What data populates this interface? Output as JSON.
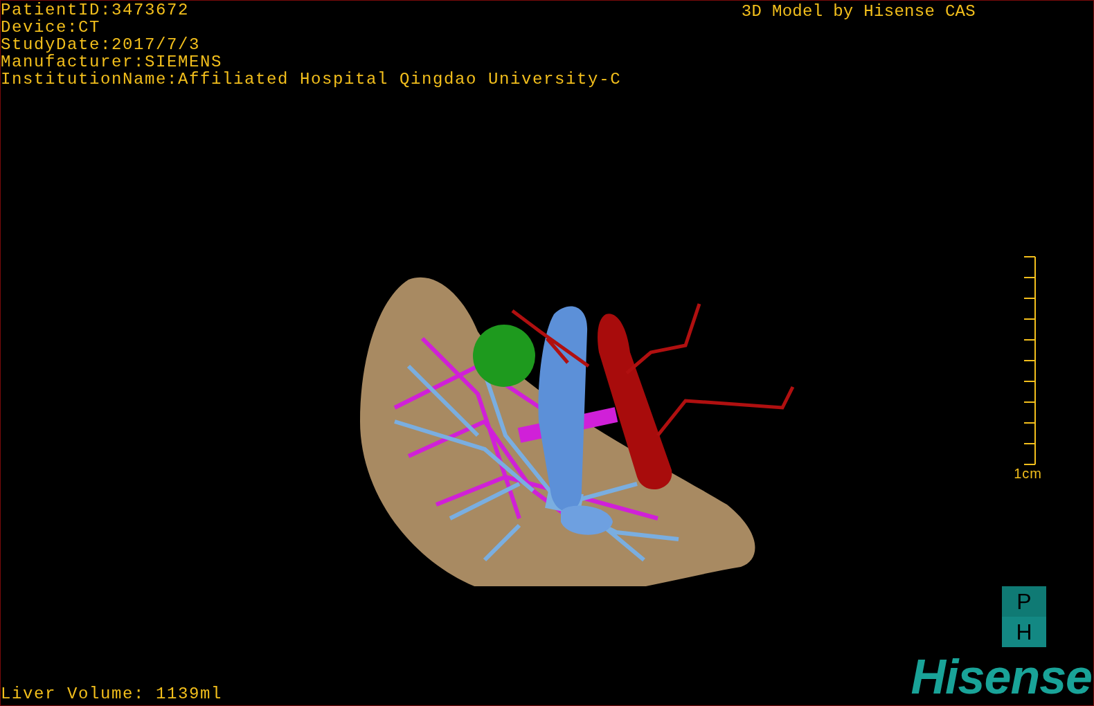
{
  "study_info": [
    "PatientID:3473672",
    "Device:CT",
    "StudyDate:2017/7/3",
    "Manufacturer:SIEMENS",
    "InstitutionName:Affiliated Hospital Qingdao University-C"
  ],
  "title": "3D Model by Hisense CAS",
  "scale_bar": {
    "label": "1cm"
  },
  "liver_volume": "Liver Volume: 1139ml",
  "logo": {
    "badge_letters": [
      "P",
      "H"
    ],
    "wordmark": "Hisense"
  }
}
